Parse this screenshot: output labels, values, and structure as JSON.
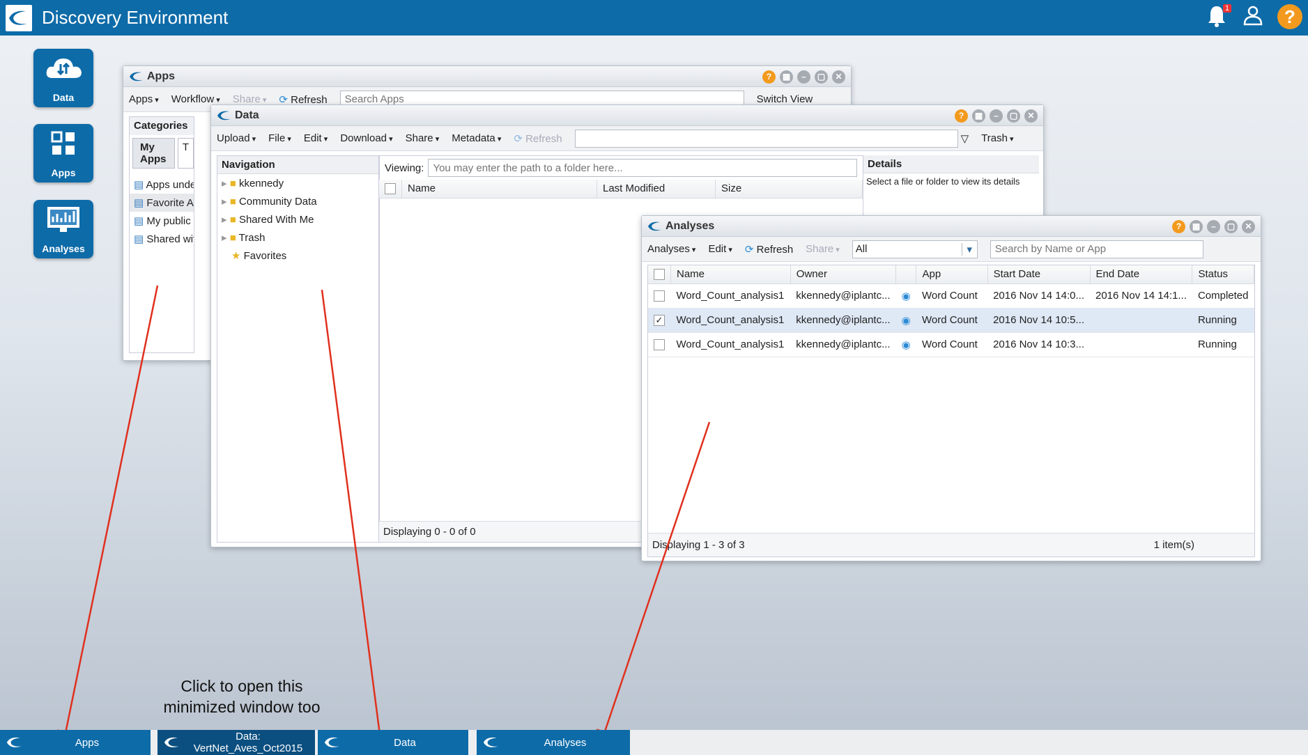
{
  "header": {
    "title": "Discovery Environment",
    "notif_count": "1",
    "help": "?"
  },
  "launchers": [
    {
      "label": "Data"
    },
    {
      "label": "Apps"
    },
    {
      "label": "Analyses"
    }
  ],
  "apps_window": {
    "title": "Apps",
    "toolbar": {
      "apps": "Apps",
      "workflow": "Workflow",
      "share": "Share",
      "refresh": "Refresh",
      "search_placeholder": "Search Apps",
      "switch_view": "Switch View"
    },
    "categories_label": "Categories",
    "tabs": [
      "My Apps",
      "T"
    ],
    "items": [
      "Apps unde",
      "Favorite Ap",
      "My public",
      "Shared wit"
    ]
  },
  "data_window": {
    "title": "Data",
    "toolbar": {
      "upload": "Upload",
      "file": "File",
      "edit": "Edit",
      "download": "Download",
      "share": "Share",
      "metadata": "Metadata",
      "refresh": "Refresh",
      "trash": "Trash"
    },
    "navigation_label": "Navigation",
    "nav_items": [
      "kkennedy",
      "Community Data",
      "Shared With Me",
      "Trash",
      "Favorites"
    ],
    "viewing_label": "Viewing:",
    "viewing_placeholder": "You may enter the path to a folder here...",
    "columns": [
      "Name",
      "Last Modified",
      "Size"
    ],
    "footer": "Displaying 0 - 0 of 0",
    "details_label": "Details",
    "details_text": "Select a file or folder to view its details"
  },
  "analyses_window": {
    "title": "Analyses",
    "toolbar": {
      "analyses": "Analyses",
      "edit": "Edit",
      "refresh": "Refresh",
      "share": "Share",
      "filter_value": "All",
      "search_placeholder": "Search by Name or App"
    },
    "columns": [
      "Name",
      "Owner",
      "App",
      "Start Date",
      "End Date",
      "Status"
    ],
    "rows": [
      {
        "name": "Word_Count_analysis1",
        "owner": "kkennedy@iplantc...",
        "app": "Word Count",
        "start": "2016 Nov 14 14:0...",
        "end": "2016 Nov 14 14:1...",
        "status": "Completed",
        "checked": false
      },
      {
        "name": "Word_Count_analysis1",
        "owner": "kkennedy@iplantc...",
        "app": "Word Count",
        "start": "2016 Nov 14 10:5...",
        "end": "",
        "status": "Running",
        "checked": true
      },
      {
        "name": "Word_Count_analysis1",
        "owner": "kkennedy@iplantc...",
        "app": "Word Count",
        "start": "2016 Nov 14 10:3...",
        "end": "",
        "status": "Running",
        "checked": false
      }
    ],
    "footer_left": "Displaying 1 - 3 of 3",
    "footer_right": "1 item(s)"
  },
  "annotation": {
    "line1": "Click to open this",
    "line2": "minimized window too"
  },
  "taskbar": [
    "Apps",
    "Data: VertNet_Aves_Oct2015",
    "Data",
    "Analyses"
  ],
  "colors": {
    "brand": "#0d6ba8",
    "accent": "#f39a1e",
    "arrow": "#e0301e"
  }
}
